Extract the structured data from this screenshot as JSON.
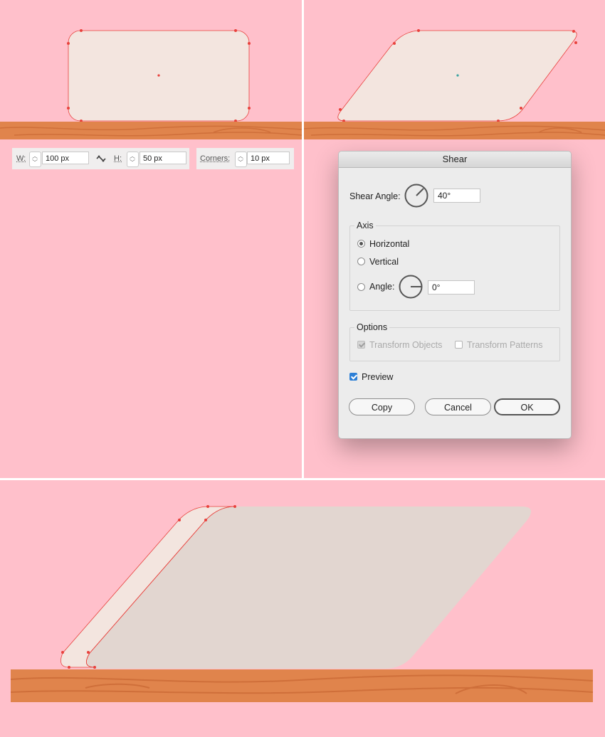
{
  "colors": {
    "background": "#ffc0cb",
    "shape_fill": "#f3e5df",
    "shape_fill_back": "#e2d6d0",
    "anchor": "#e8413c",
    "wood": "#e0844c",
    "wood_grain": "#cf6f3a",
    "accent": "#2d7fd6"
  },
  "toolbar": {
    "w_label": "W:",
    "w_value": "100 px",
    "h_label": "H:",
    "h_value": "50 px",
    "link_icon": "unlink-icon",
    "corners_label": "Corners:",
    "corners_value": "10 px"
  },
  "dialog": {
    "title": "Shear",
    "shear_angle_label": "Shear Angle:",
    "shear_angle_value": "40°",
    "axis_title": "Axis",
    "horizontal_label": "Horizontal",
    "vertical_label": "Vertical",
    "angle_label": "Angle:",
    "angle_value": "0°",
    "selected_axis": "horizontal",
    "options_title": "Options",
    "transform_objects_label": "Transform Objects",
    "transform_objects_checked": true,
    "transform_objects_enabled": false,
    "transform_patterns_label": "Transform Patterns",
    "transform_patterns_checked": false,
    "transform_patterns_enabled": false,
    "preview_label": "Preview",
    "preview_checked": true,
    "copy_label": "Copy",
    "cancel_label": "Cancel",
    "ok_label": "OK"
  }
}
